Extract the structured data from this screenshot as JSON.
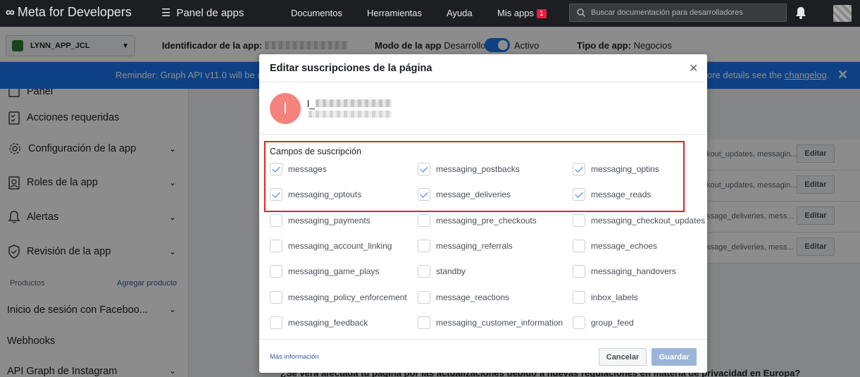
{
  "topnav": {
    "logo_text": "Meta for Developers",
    "menu_label": "Panel de apps",
    "links": [
      "Documentos",
      "Herramientas",
      "Ayuda",
      "Mis apps"
    ],
    "mis_apps_badge": "1",
    "search_placeholder": "Buscar documentación para desarrolladores"
  },
  "appbar": {
    "app_name": "LYNN_APP_JCL",
    "id_label": "Identificador de la app:",
    "mode_label": "Modo de la app",
    "mode_left": "Desarrollo",
    "mode_right": "Activo",
    "type_label": "Tipo de app:",
    "type_value": "Negocios"
  },
  "banner": {
    "left_text": "Reminder: Graph API v11.0 will be de",
    "right_text": "ore details see the",
    "link_text": "changelog",
    "tail": "."
  },
  "sidebar": {
    "items": [
      {
        "label": "Panel"
      },
      {
        "label": "Acciones requeridas"
      },
      {
        "label": "Configuración de la app"
      },
      {
        "label": "Roles de la app"
      },
      {
        "label": "Alertas"
      },
      {
        "label": "Revisión de la app"
      }
    ],
    "products_label": "Productos",
    "add_product_label": "Agregar producto",
    "products": [
      {
        "label": "Inicio de sesión con Faceboo..."
      },
      {
        "label": "Webhooks"
      },
      {
        "label": "API Graph de Instagram"
      }
    ]
  },
  "background": {
    "rows": [
      {
        "text": "kout_updates, messagin...",
        "edit": "Editar"
      },
      {
        "text": "kout_updates, messagin...",
        "edit": "Editar"
      },
      {
        "text": "ssage_deliveries, mess...",
        "edit": "Editar"
      },
      {
        "text": "ssage_deliveries, mess...",
        "edit": "Editar"
      }
    ],
    "bottom_question": "¿Se verá afectada tu página por las actualizaciones debido a nuevas regulaciones en materia de privacidad en Europa?"
  },
  "modal": {
    "title": "Editar suscripciones de la página",
    "close_glyph": "✕",
    "page_initial": "l",
    "page_name_prefix": "l_",
    "fields_title": "Campos de suscripción",
    "fields": [
      {
        "label": "messages",
        "checked": true
      },
      {
        "label": "messaging_postbacks",
        "checked": true
      },
      {
        "label": "messaging_optins",
        "checked": true
      },
      {
        "label": "messaging_optouts",
        "checked": true
      },
      {
        "label": "message_deliveries",
        "checked": true
      },
      {
        "label": "message_reads",
        "checked": true
      },
      {
        "label": "messaging_payments",
        "checked": false
      },
      {
        "label": "messaging_pre_checkouts",
        "checked": false
      },
      {
        "label": "messaging_checkout_updates",
        "checked": false
      },
      {
        "label": "messaging_account_linking",
        "checked": false
      },
      {
        "label": "messaging_referrals",
        "checked": false
      },
      {
        "label": "message_echoes",
        "checked": false
      },
      {
        "label": "messaging_game_plays",
        "checked": false
      },
      {
        "label": "standby",
        "checked": false
      },
      {
        "label": "messaging_handovers",
        "checked": false
      },
      {
        "label": "messaging_policy_enforcement",
        "checked": false
      },
      {
        "label": "message_reactions",
        "checked": false
      },
      {
        "label": "inbox_labels",
        "checked": false
      },
      {
        "label": "messaging_feedback",
        "checked": false
      },
      {
        "label": "messaging_customer_information",
        "checked": false
      },
      {
        "label": "group_feed",
        "checked": false
      }
    ],
    "more_info": "Más información",
    "cancel_label": "Cancelar",
    "save_label": "Guardar"
  },
  "colors": {
    "accent": "#1877f2",
    "highlight": "#d9262b",
    "avatar": "#f4837d"
  }
}
